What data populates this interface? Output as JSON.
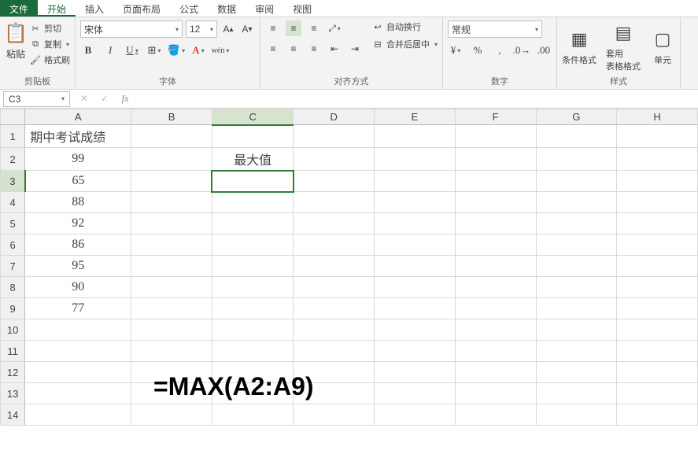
{
  "tabs": {
    "file": "文件",
    "start": "开始",
    "insert": "插入",
    "layout": "页面布局",
    "formula": "公式",
    "data": "数据",
    "review": "审阅",
    "view": "视图"
  },
  "ribbon": {
    "clipboard": {
      "paste": "粘贴",
      "cut": "剪切",
      "copy": "复制",
      "format_painter": "格式刷",
      "label": "剪贴板"
    },
    "font": {
      "name": "宋体",
      "size": "12",
      "label": "字体",
      "bold": "B",
      "italic": "I",
      "underline": "U",
      "wen": "wén"
    },
    "align": {
      "wrap": "自动换行",
      "merge": "合并后居中",
      "label": "对齐方式"
    },
    "number": {
      "format": "常规",
      "label": "数字"
    },
    "styles": {
      "cond_format": "条件格式",
      "table_format": "套用\n表格格式",
      "cell_style": "单元",
      "label": "样式"
    }
  },
  "name_box": "C3",
  "formula_bar": "",
  "columns": [
    "A",
    "B",
    "C",
    "D",
    "E",
    "F",
    "G",
    "H"
  ],
  "rows": [
    "1",
    "2",
    "3",
    "4",
    "5",
    "6",
    "7",
    "8",
    "9",
    "10",
    "11",
    "12",
    "13",
    "14"
  ],
  "cells": {
    "A1": "期中考试成绩",
    "A2": "99",
    "A3": "65",
    "A4": "88",
    "A5": "92",
    "A6": "86",
    "A7": "95",
    "A8": "90",
    "A9": "77",
    "C2": "最大值"
  },
  "overlay_formula": "=MAX(A2:A9)",
  "selected_cell": "C3"
}
